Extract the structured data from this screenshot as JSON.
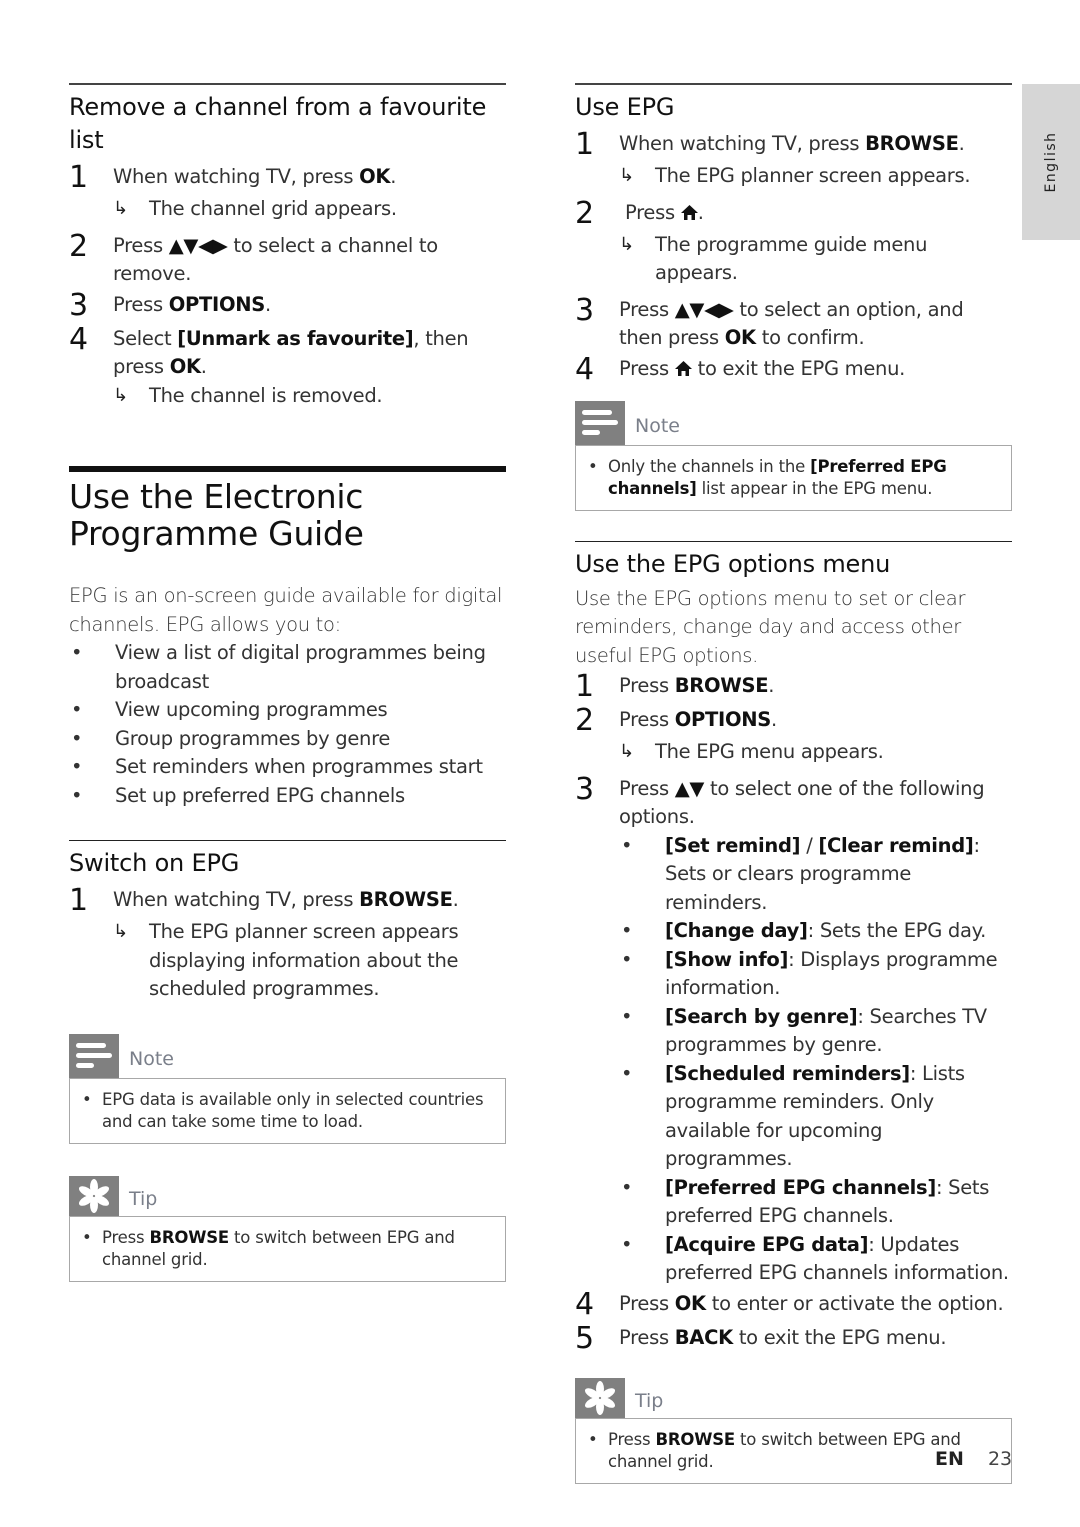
{
  "left": {
    "remove_section": {
      "title": "Remove a channel from a favourite list",
      "steps": [
        {
          "num": "1",
          "pre": "When watching TV, press ",
          "key": "OK",
          "post": ".",
          "result": "The channel grid appears."
        },
        {
          "num": "2",
          "pre": "Press ",
          "arrows": "▲▼◀▶",
          "post": " to select a channel to remove."
        },
        {
          "num": "3",
          "pre": "Press ",
          "key": "OPTIONS",
          "post": "."
        },
        {
          "num": "4",
          "pre": "Select ",
          "key": "[Unmark as favourite]",
          "mid": ", then press ",
          "key2": "OK",
          "post": ".",
          "result": "The channel is removed."
        }
      ]
    },
    "epg_section": {
      "title_line1": "Use the Electronic",
      "title_line2": "Programme Guide",
      "intro": "EPG is an on-screen guide available for digital channels. EPG allows you to:",
      "bullets": [
        "View a list of digital programmes being broadcast",
        "View upcoming programmes",
        "Group programmes by genre",
        "Set reminders when programmes start",
        "Set up preferred EPG channels"
      ]
    },
    "switch_section": {
      "title": "Switch on EPG",
      "steps": [
        {
          "num": "1",
          "pre": "When watching TV, press ",
          "key": "BROWSE",
          "post": ".",
          "result": "The EPG planner screen appears displaying information about the scheduled programmes."
        }
      ]
    },
    "note": {
      "label": "Note",
      "text": "EPG data is available only in selected countries and can take some time to load."
    },
    "tip": {
      "label": "Tip",
      "pre": "Press ",
      "key": "BROWSE",
      "post": " to switch between EPG and channel grid."
    }
  },
  "right": {
    "use_epg": {
      "title": "Use EPG",
      "steps": [
        {
          "num": "1",
          "pre": "When watching TV, press ",
          "key": "BROWSE",
          "post": ".",
          "result": "The EPG planner screen appears."
        },
        {
          "num": "2",
          "pre": "Press ",
          "icon": "home-icon",
          "post": ".",
          "result": "The programme guide menu appears."
        },
        {
          "num": "3",
          "pre": "Press ",
          "arrows": "▲▼◀▶",
          "mid": " to select an option, and then press ",
          "key": "OK",
          "post": " to confirm."
        },
        {
          "num": "4",
          "pre": "Press ",
          "icon": "home-icon",
          "post": " to exit the EPG menu."
        }
      ]
    },
    "note": {
      "label": "Note",
      "pre": "Only the channels in the ",
      "key": "[Preferred EPG channels]",
      "post": " list appear in the EPG menu."
    },
    "options_section": {
      "title": "Use the EPG options menu",
      "intro": "Use the EPG options menu to set or clear reminders, change day and access other useful EPG options.",
      "steps": [
        {
          "num": "1",
          "pre": "Press ",
          "key": "BROWSE",
          "post": "."
        },
        {
          "num": "2",
          "pre": "Press ",
          "key": "OPTIONS",
          "post": ".",
          "result": "The EPG menu appears."
        },
        {
          "num": "3",
          "pre": "Press ",
          "arrows": "▲▼",
          "post": " to select one of the following options."
        },
        {
          "num": "4",
          "pre": "Press ",
          "key": "OK",
          "post": " to enter or activate the option."
        },
        {
          "num": "5",
          "pre": "Press ",
          "key": "BACK",
          "post": " to exit the EPG menu."
        }
      ],
      "options": [
        {
          "key": "[Set remind]",
          "sep": " / ",
          "key2": "[Clear remind]",
          "desc": ": Sets or clears programme reminders."
        },
        {
          "key": "[Change day]",
          "desc": ": Sets the EPG day."
        },
        {
          "key": "[Show info]",
          "desc": ": Displays programme information."
        },
        {
          "key": "[Search by genre]",
          "desc": ": Searches TV programmes by genre."
        },
        {
          "key": "[Scheduled reminders]",
          "desc": ": Lists programme reminders. Only available for upcoming programmes."
        },
        {
          "key": "[Preferred EPG channels]",
          "desc": ": Sets preferred EPG channels."
        },
        {
          "key": "[Acquire EPG data]",
          "desc": ": Updates preferred EPG channels information."
        }
      ]
    },
    "tip": {
      "label": "Tip",
      "pre": "Press ",
      "key": "BROWSE",
      "post": " to switch between EPG and channel grid."
    }
  },
  "side_tab": {
    "label": "English"
  },
  "footer": {
    "lang": "EN",
    "page": "23"
  },
  "symbols": {
    "arrow": "↳",
    "bullet": "•"
  }
}
